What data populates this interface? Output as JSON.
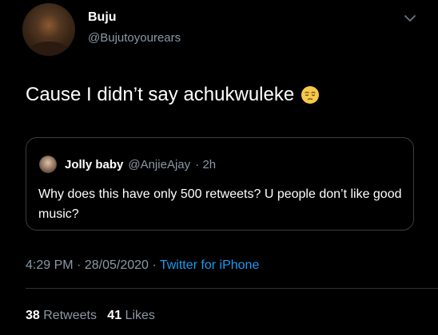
{
  "author": {
    "display_name": "Buju",
    "handle": "@Bujutoyourears"
  },
  "tweet": {
    "text": "Cause I didn’t say achukwuleke",
    "emoji": "pensive-face-icon"
  },
  "quoted_tweet": {
    "display_name": "Jolly baby",
    "handle": "@AnjieAjay",
    "time_ago": "· 2h",
    "text": "Why does this have only 500 retweets? U people don’t like good music?"
  },
  "meta": {
    "time": "4:29 PM",
    "date": "28/05/2020",
    "separator": "·",
    "source": "Twitter for iPhone"
  },
  "stats": {
    "retweets_count": "38",
    "retweets_label": "Retweets",
    "likes_count": "41",
    "likes_label": "Likes"
  },
  "colors": {
    "background": "#000000",
    "secondary_text": "#8b98a5",
    "link": "#1d9bf0",
    "border": "#3a3f45"
  }
}
